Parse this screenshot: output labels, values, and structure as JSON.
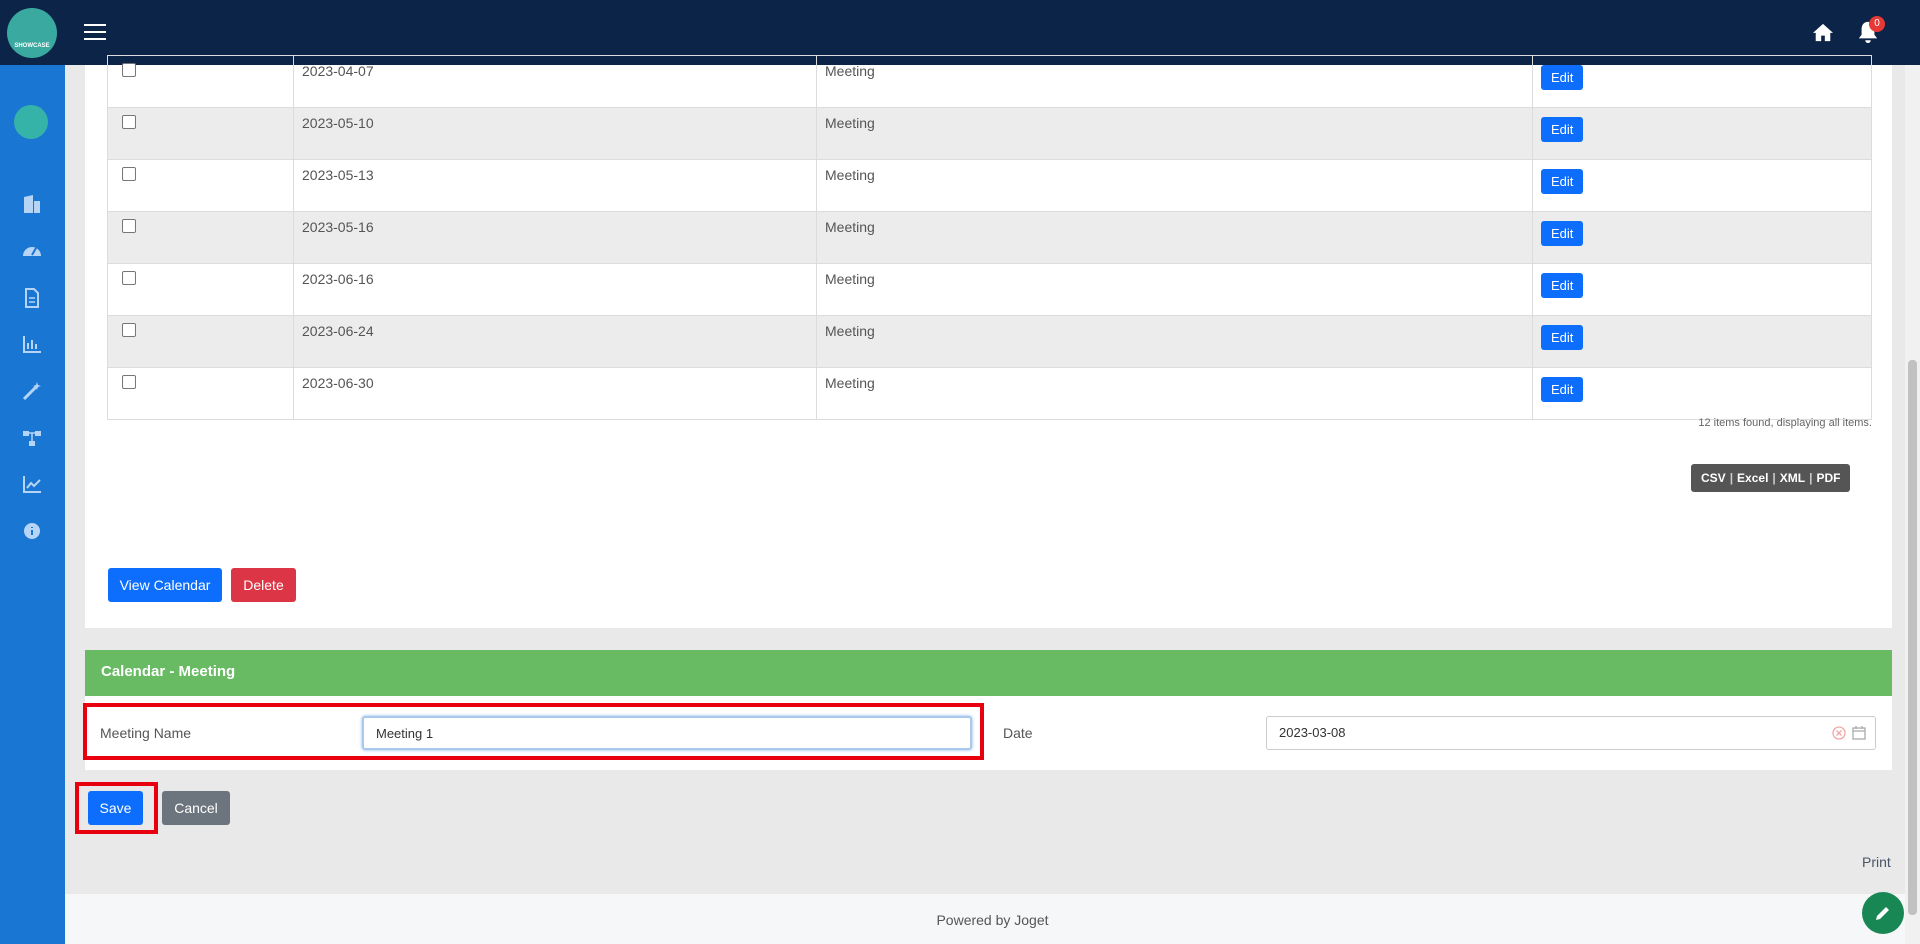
{
  "topbar": {
    "logo_text": "SHOWCASE",
    "notification_count": "0"
  },
  "table": {
    "rows": [
      {
        "date": "2023-04-07",
        "type": "Meeting",
        "action": "Edit"
      },
      {
        "date": "2023-05-10",
        "type": "Meeting",
        "action": "Edit"
      },
      {
        "date": "2023-05-13",
        "type": "Meeting",
        "action": "Edit"
      },
      {
        "date": "2023-05-16",
        "type": "Meeting",
        "action": "Edit"
      },
      {
        "date": "2023-06-16",
        "type": "Meeting",
        "action": "Edit"
      },
      {
        "date": "2023-06-24",
        "type": "Meeting",
        "action": "Edit"
      },
      {
        "date": "2023-06-30",
        "type": "Meeting",
        "action": "Edit"
      }
    ],
    "found_text": "12 items found, displaying all items.",
    "export": [
      "CSV",
      "Excel",
      "XML",
      "PDF"
    ]
  },
  "buttons": {
    "view_calendar": "View Calendar",
    "delete": "Delete",
    "save": "Save",
    "cancel": "Cancel"
  },
  "form": {
    "title": "Calendar - Meeting",
    "meeting_name_label": "Meeting Name",
    "meeting_name_value": "Meeting 1",
    "date_label": "Date",
    "date_value": "2023-03-08"
  },
  "print_label": "Print",
  "footer": "Powered by Joget",
  "colors": {
    "topbar": "#0b2447",
    "sidebar": "#1976d2",
    "primary": "#0d6efd",
    "danger": "#dc3545",
    "form_header": "#68bb63",
    "highlight": "#e8000e"
  }
}
